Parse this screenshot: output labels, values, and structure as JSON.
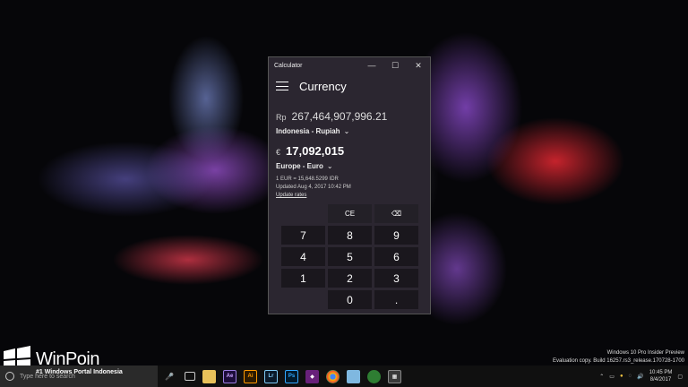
{
  "calculator": {
    "title": "Calculator",
    "mode": "Currency",
    "window_buttons": {
      "minimize": "—",
      "maximize": "☐",
      "close": "✕"
    },
    "from": {
      "symbol": "Rp",
      "amount": "267,464,907,996.21",
      "currency": "Indonesia - Rupiah"
    },
    "to": {
      "symbol": "€",
      "amount": "17,092,015",
      "currency": "Europe - Euro"
    },
    "rate": "1 EUR = 15,648.5299 IDR",
    "updated": "Updated Aug 4, 2017 10:42 PM",
    "update_link": "Update rates",
    "keys": {
      "ce": "CE",
      "backspace": "⌫",
      "k7": "7",
      "k8": "8",
      "k9": "9",
      "k4": "4",
      "k5": "5",
      "k6": "6",
      "k1": "1",
      "k2": "2",
      "k3": "3",
      "k0": "0",
      "dot": "."
    }
  },
  "watermark": {
    "line1": "Windows 10 Pro Insider Preview",
    "line2": "Evaluation copy. Build 16257.rs3_release.170728-1700"
  },
  "logo": {
    "text": "WinPoin",
    "subtitle": "#1 Windows Portal Indonesia"
  },
  "taskbar": {
    "search_placeholder": "Type here to search",
    "time": "10:45 PM",
    "date": "8/4/2017",
    "apps": [
      "Ae",
      "Ai",
      "Lr",
      "Ps"
    ]
  },
  "colors": {
    "accent": "#2b2630",
    "keys": "#1a171d"
  }
}
